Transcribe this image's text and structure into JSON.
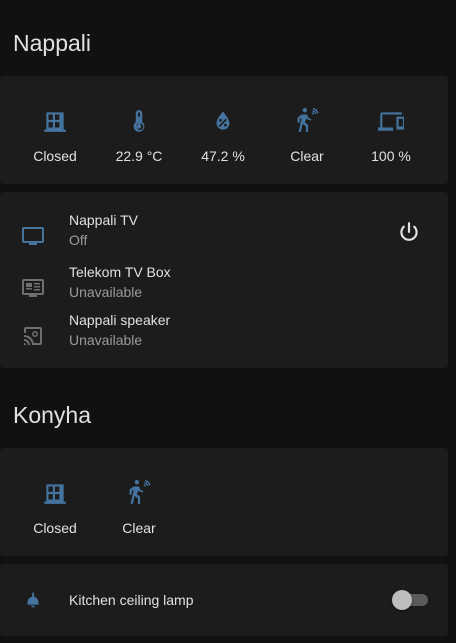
{
  "nappali": {
    "title": "Nappali",
    "sensors": [
      {
        "icon": "window-closed-icon",
        "value": "Closed"
      },
      {
        "icon": "thermometer-icon",
        "value": "22.9 °C"
      },
      {
        "icon": "water-percent-icon",
        "value": "47.2 %"
      },
      {
        "icon": "motion-sensor-icon",
        "value": "Clear"
      },
      {
        "icon": "devices-icon",
        "value": "100 %"
      }
    ],
    "media": [
      {
        "icon": "television-icon",
        "name": "Nappali TV",
        "state": "Off"
      },
      {
        "icon": "tv-box-icon",
        "name": "Telekom TV Box",
        "state": "Unavailable"
      },
      {
        "icon": "speaker-cast-icon",
        "name": "Nappali speaker",
        "state": "Unavailable"
      }
    ]
  },
  "konyha": {
    "title": "Konyha",
    "sensors": [
      {
        "icon": "window-closed-icon",
        "value": "Closed"
      },
      {
        "icon": "motion-sensor-icon",
        "value": "Clear"
      }
    ],
    "lights": [
      {
        "icon": "ceiling-light-icon",
        "name": "Kitchen ceiling lamp",
        "on": false
      }
    ]
  },
  "colors": {
    "accent": "#44739e",
    "background": "#111111",
    "card": "#1c1c1c",
    "disabled_icon": "#6f6f6f",
    "secondary_text": "#9b9b9b"
  }
}
